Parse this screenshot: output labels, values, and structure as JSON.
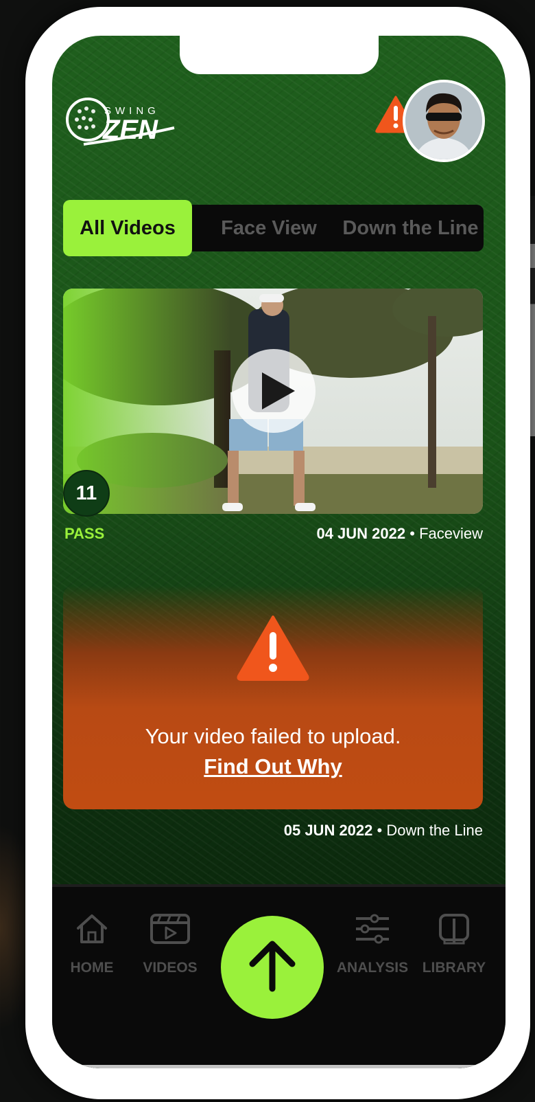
{
  "header": {
    "logo_top": "SWING",
    "logo_main": "ZEN"
  },
  "tabs": [
    {
      "label": "All Videos",
      "active": true
    },
    {
      "label": "Face View",
      "active": false
    },
    {
      "label": "Down the Line",
      "active": false
    }
  ],
  "videos": [
    {
      "score": "11",
      "status": "PASS",
      "date": "04 JUN 2022",
      "separator": "•",
      "view": "Faceview"
    }
  ],
  "failed_upload": {
    "message": "Your video failed to upload.",
    "link": "Find Out Why",
    "date": "05 JUN 2022",
    "separator": "•",
    "view": "Down the Line"
  },
  "nav": {
    "home": "HOME",
    "videos": "VIDEOS",
    "analysis": "ANALYSIS",
    "library": "LIBRARY"
  },
  "colors": {
    "accent": "#9af13b",
    "alert": "#f0561c",
    "failed_card": "#c14c12"
  },
  "icons": {
    "alert": "warning-triangle-icon",
    "upload": "arrow-up-icon",
    "home": "house-icon",
    "videos": "clapperboard-play-icon",
    "analysis": "sliders-icon",
    "library": "book-icon"
  }
}
